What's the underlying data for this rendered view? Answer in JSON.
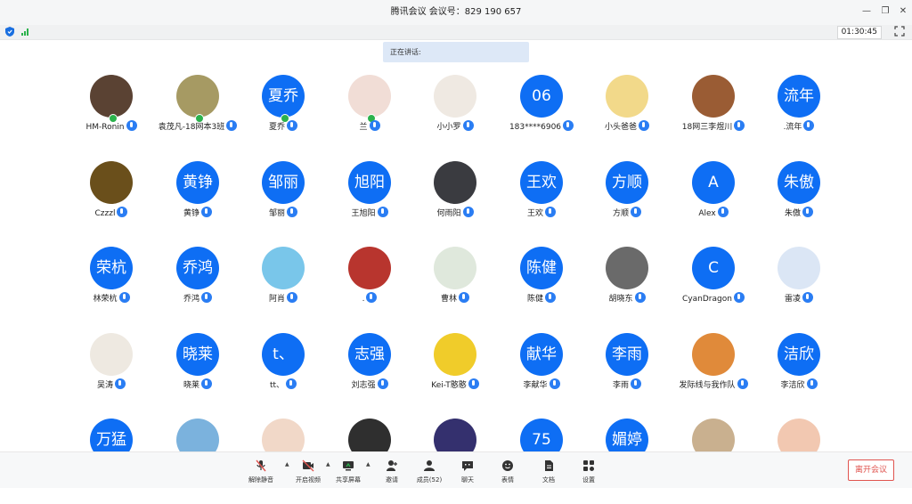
{
  "window": {
    "title": "腾讯会议  会议号：829 190 657"
  },
  "status": {
    "timer": "01:30:45"
  },
  "speaking": {
    "label": "正在讲话:"
  },
  "participants": [
    {
      "name": "HM-Ronin",
      "avatar": "",
      "photo": "#5a4233",
      "talking": true
    },
    {
      "name": "袁茂凡-18网本3班",
      "avatar": "",
      "photo": "#a69a63",
      "talking": true
    },
    {
      "name": "夏乔",
      "avatar": "夏乔",
      "talking": true
    },
    {
      "name": "兰",
      "avatar": "",
      "photo": "#f1ddd6",
      "talking": true
    },
    {
      "name": "小小罗",
      "avatar": "",
      "photo": "#efe9e2",
      "talking": false
    },
    {
      "name": "183****6906",
      "avatar": "06",
      "talking": false
    },
    {
      "name": "小头爸爸",
      "avatar": "",
      "photo": "#f2d98a",
      "talking": false
    },
    {
      "name": "18网三李煜川",
      "avatar": "",
      "photo": "#9a5c34",
      "talking": false
    },
    {
      "name": ".流年",
      "avatar": "流年",
      "talking": false
    },
    {
      "name": "Czzzl",
      "avatar": "",
      "photo": "#6a4f1b",
      "talking": false
    },
    {
      "name": "黄铮",
      "avatar": "黄铮",
      "talking": false
    },
    {
      "name": "邹丽",
      "avatar": "邹丽",
      "talking": false
    },
    {
      "name": "王旭阳",
      "avatar": "旭阳",
      "talking": false
    },
    {
      "name": "何雨阳",
      "avatar": "",
      "photo": "#3a3b40",
      "talking": false
    },
    {
      "name": "王欢",
      "avatar": "王欢",
      "talking": false
    },
    {
      "name": "方顺",
      "avatar": "方顺",
      "talking": false
    },
    {
      "name": "Alex",
      "avatar": "A",
      "talking": false
    },
    {
      "name": "朱傲",
      "avatar": "朱傲",
      "talking": false
    },
    {
      "name": "林荣杭",
      "avatar": "荣杭",
      "talking": false
    },
    {
      "name": "乔鸿",
      "avatar": "乔鸿",
      "talking": false
    },
    {
      "name": "阿肖",
      "avatar": "",
      "photo": "#79c6ea",
      "talking": false
    },
    {
      "name": ".",
      "avatar": "",
      "photo": "#b8352e",
      "talking": false
    },
    {
      "name": "曹林",
      "avatar": "",
      "photo": "#dfe8dc",
      "talking": false
    },
    {
      "name": "陈健",
      "avatar": "陈健",
      "talking": false
    },
    {
      "name": "胡晓东",
      "avatar": "",
      "photo": "#6a6a6a",
      "talking": false
    },
    {
      "name": "CyanDragon",
      "avatar": "C",
      "talking": false
    },
    {
      "name": "雷凌",
      "avatar": "",
      "photo": "#dbe6f5",
      "talking": false
    },
    {
      "name": "吴涛",
      "avatar": "",
      "photo": "#eee9e1",
      "talking": false
    },
    {
      "name": "晓莱",
      "avatar": "晓莱",
      "talking": false
    },
    {
      "name": "tt、",
      "avatar": "t、",
      "talking": false
    },
    {
      "name": "刘志强",
      "avatar": "志强",
      "talking": false
    },
    {
      "name": "Kei-T憨憨",
      "avatar": "",
      "photo": "#f0cc2a",
      "talking": false
    },
    {
      "name": "李献华",
      "avatar": "献华",
      "talking": false
    },
    {
      "name": "李雨",
      "avatar": "李雨",
      "talking": false
    },
    {
      "name": "发际线与我作队",
      "avatar": "",
      "photo": "#e08a3a",
      "talking": false
    },
    {
      "name": "李洁欣",
      "avatar": "洁欣",
      "talking": false
    },
    {
      "name": "",
      "avatar": "万猛",
      "talking": false
    },
    {
      "name": "",
      "avatar": "",
      "photo": "#7bb2dd",
      "talking": false
    },
    {
      "name": "",
      "avatar": "",
      "photo": "#f1d8c8",
      "talking": false
    },
    {
      "name": "",
      "avatar": "",
      "photo": "#2f2f2f",
      "talking": false
    },
    {
      "name": "",
      "avatar": "",
      "photo": "#34306e",
      "talking": false
    },
    {
      "name": "",
      "avatar": "75",
      "talking": false
    },
    {
      "name": "",
      "avatar": "媚婷",
      "talking": false
    },
    {
      "name": "",
      "avatar": "",
      "photo": "#c9b08f",
      "talking": false
    },
    {
      "name": "",
      "avatar": "",
      "photo": "#f2c8b1",
      "talking": false
    }
  ],
  "toolbar": {
    "unmute": "解除静音",
    "start_video": "开启视频",
    "share_screen": "共享屏幕",
    "invite": "邀请",
    "members": "成员(52)",
    "chat": "聊天",
    "reactions": "表情",
    "docs": "文档",
    "settings": "设置",
    "leave": "离开会议"
  },
  "colors": {
    "accent": "#0e6ef4",
    "leave": "#e0544f",
    "speaking_bg": "#dde8f7"
  }
}
